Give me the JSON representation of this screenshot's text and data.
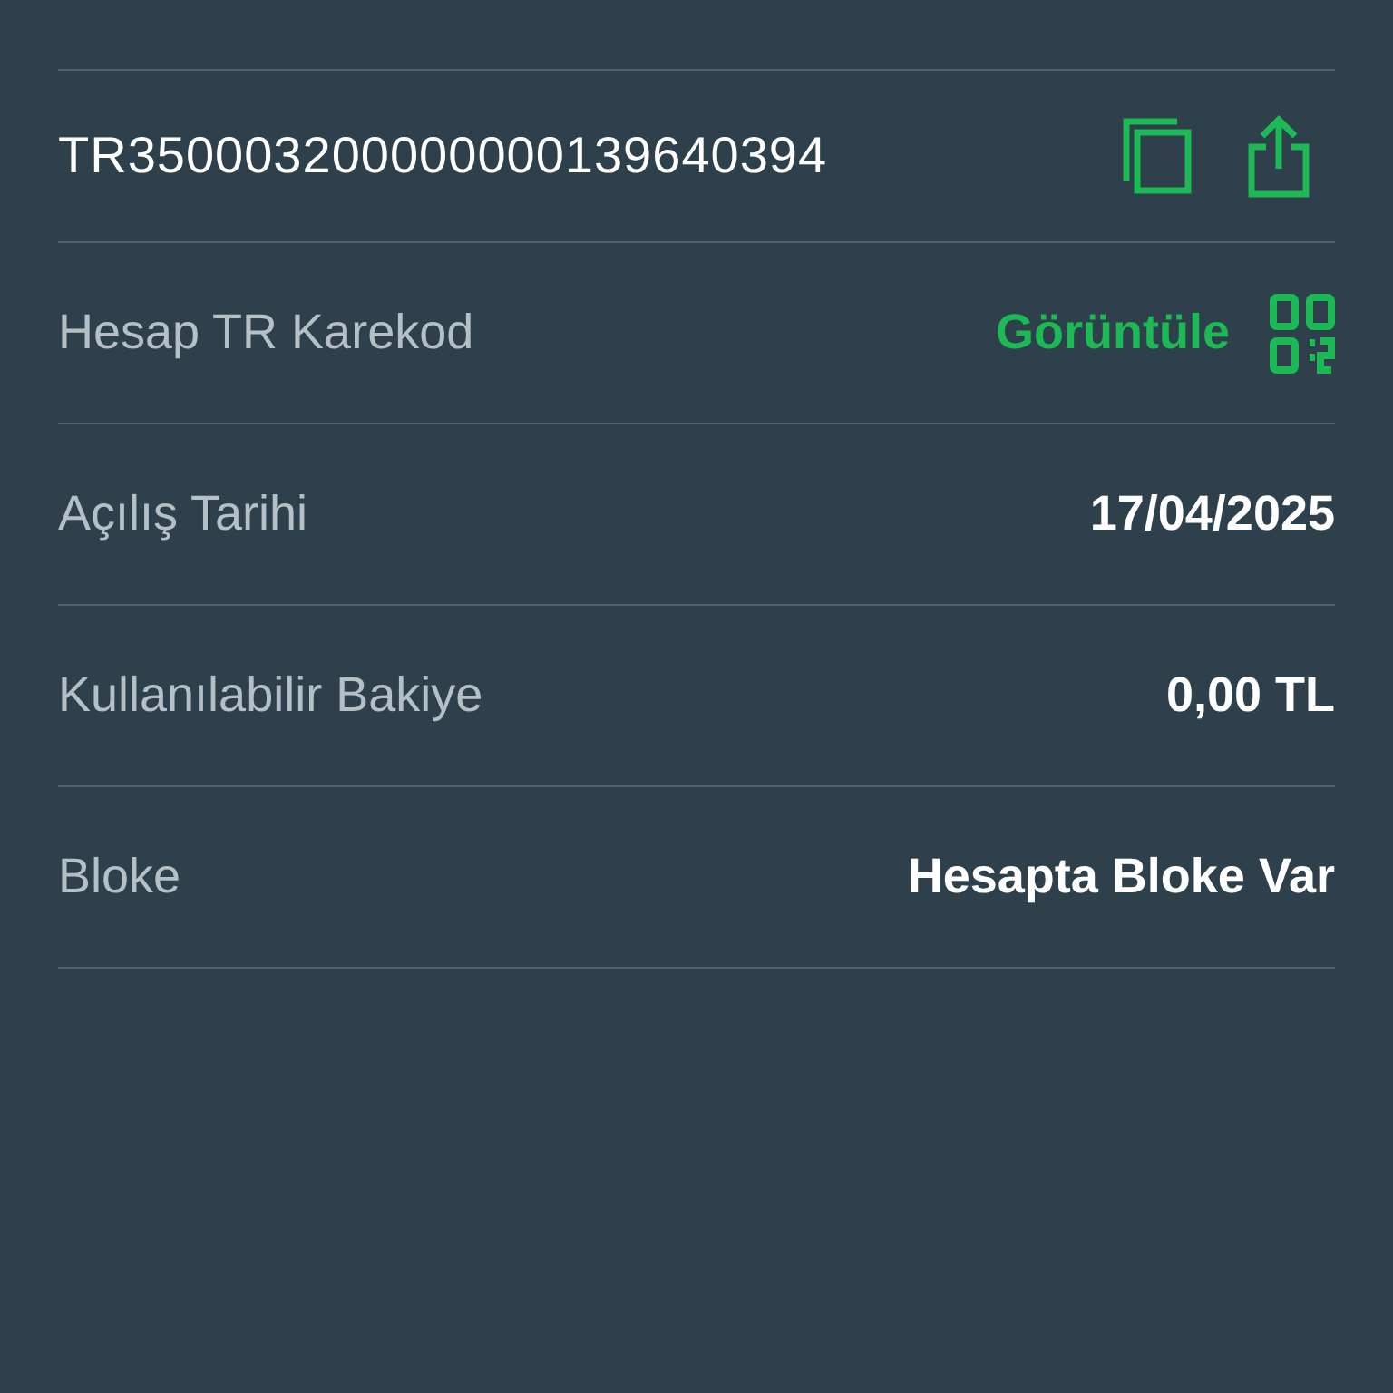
{
  "iban": {
    "value": "TR350003200000000139640394"
  },
  "rows": [
    {
      "kind": "action",
      "label": "Hesap TR Karekod",
      "value": "Görüntüle"
    },
    {
      "kind": "text",
      "label": "Açılış Tarihi",
      "value": "17/04/2025"
    },
    {
      "kind": "text",
      "label": "Kullanılabilir Bakiye",
      "value": "0,00 TL"
    },
    {
      "kind": "text",
      "label": "Bloke",
      "value": "Hesapta Bloke Var"
    }
  ]
}
